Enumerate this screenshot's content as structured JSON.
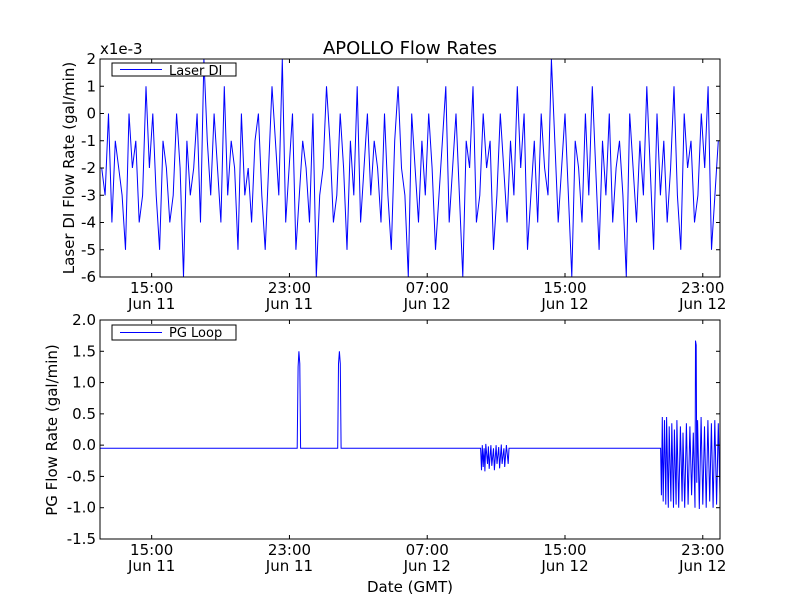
{
  "chart_data": [
    {
      "type": "line",
      "title": "APOLLO Flow Rates",
      "ylabel": "Laser DI Flow Rate (gal/min)",
      "xlabel": "",
      "scale_note": "x1e-3",
      "legend": [
        "Laser DI"
      ],
      "legend_position": "top-left",
      "color": "#0000ff",
      "x_unit": "hours since Jun 11 12:00 GMT",
      "xlim": [
        0,
        36
      ],
      "ylim": [
        -6,
        2
      ],
      "yticks": [
        "-6",
        "-5",
        "-4",
        "-3",
        "-2",
        "-1",
        "0",
        "1",
        "2"
      ],
      "xticks": [
        {
          "at": 3,
          "time": "15:00",
          "date": "Jun 11"
        },
        {
          "at": 11,
          "time": "23:00",
          "date": "Jun 11"
        },
        {
          "at": 19,
          "time": "07:00",
          "date": "Jun 12"
        },
        {
          "at": 27,
          "time": "15:00",
          "date": "Jun 12"
        },
        {
          "at": 35,
          "time": "23:00",
          "date": "Jun 12"
        }
      ],
      "series": [
        {
          "name": "Laser DI",
          "values": [
            -2,
            -3,
            0,
            -4,
            -1,
            -2,
            -3,
            -5,
            0,
            -2,
            -1,
            -4,
            -3,
            1,
            -2,
            0,
            -3,
            -5,
            -1,
            -2,
            -4,
            -3,
            0,
            -2,
            -6,
            -1,
            -3,
            -2,
            0,
            -4,
            2,
            -1,
            -3,
            0,
            -2,
            -4,
            1,
            -3,
            -1,
            -2,
            -5,
            0,
            -3,
            -2,
            -4,
            -1,
            0,
            -3,
            -5,
            -2,
            1,
            -1,
            -3,
            2,
            -4,
            -2,
            0,
            -5,
            -3,
            -1,
            -2,
            -4,
            0,
            -6,
            -3,
            -2,
            1,
            -1,
            -4,
            -3,
            0,
            -2,
            -5,
            -1,
            -3,
            1,
            -4,
            -2,
            0,
            -3,
            -1,
            -2,
            -4,
            0,
            -3,
            -5,
            -1,
            1,
            -2,
            -3,
            -6,
            0,
            -2,
            -4,
            -1,
            -3,
            0,
            -2,
            -5,
            -3,
            -1,
            1,
            -4,
            -2,
            0,
            -3,
            -6,
            -1,
            -2,
            1,
            -4,
            -3,
            0,
            -2,
            -1,
            -5,
            -3,
            0,
            -2,
            -4,
            -1,
            -3,
            1,
            -2,
            0,
            -5,
            -3,
            -1,
            -4,
            0,
            -2,
            -3,
            2,
            -1,
            -4,
            -2,
            0,
            -3,
            -6,
            -1,
            -2,
            -4,
            0,
            -3,
            1,
            -2,
            -5,
            -1,
            -3,
            0,
            -4,
            -2,
            -1,
            -3,
            -6,
            0,
            -2,
            -4,
            -1,
            -3,
            1,
            -2,
            -5,
            0,
            -3,
            -1,
            -4,
            -2,
            1,
            -3,
            -5,
            0,
            -2,
            -1,
            -4,
            -3,
            0,
            -2,
            1,
            -5,
            -3,
            -1
          ]
        }
      ]
    },
    {
      "type": "line",
      "title": "",
      "ylabel": "PG Flow Rate (gal/min)",
      "xlabel": "Date (GMT)",
      "legend": [
        "PG Loop"
      ],
      "legend_position": "top-left",
      "color": "#0000ff",
      "x_unit": "hours since Jun 11 12:00 GMT",
      "xlim": [
        0,
        36
      ],
      "ylim": [
        -1.5,
        2.0
      ],
      "yticks": [
        "-1.5",
        "-1.0",
        "-0.5",
        "0.0",
        "0.5",
        "1.0",
        "1.5",
        "2.0"
      ],
      "xticks": [
        {
          "at": 3,
          "time": "15:00",
          "date": "Jun 11"
        },
        {
          "at": 11,
          "time": "23:00",
          "date": "Jun 11"
        },
        {
          "at": 19,
          "time": "07:00",
          "date": "Jun 12"
        },
        {
          "at": 27,
          "time": "15:00",
          "date": "Jun 12"
        },
        {
          "at": 35,
          "time": "23:00",
          "date": "Jun 12"
        }
      ],
      "series": [
        {
          "name": "PG Loop",
          "points": [
            [
              0,
              -0.05
            ],
            [
              11.45,
              -0.05
            ],
            [
              11.5,
              1.25
            ],
            [
              11.55,
              1.5
            ],
            [
              11.6,
              1.3
            ],
            [
              11.65,
              -0.05
            ],
            [
              13.8,
              -0.05
            ],
            [
              13.85,
              1.3
            ],
            [
              13.9,
              1.5
            ],
            [
              13.95,
              1.3
            ],
            [
              14.0,
              -0.05
            ],
            [
              22.1,
              -0.05
            ],
            [
              22.15,
              -0.4
            ],
            [
              22.2,
              0.0
            ],
            [
              22.25,
              -0.35
            ],
            [
              22.3,
              -0.05
            ],
            [
              22.35,
              -0.42
            ],
            [
              22.4,
              0.02
            ],
            [
              22.5,
              -0.3
            ],
            [
              22.55,
              -0.02
            ],
            [
              22.6,
              -0.38
            ],
            [
              22.7,
              0.0
            ],
            [
              22.75,
              -0.33
            ],
            [
              22.85,
              -0.05
            ],
            [
              22.9,
              -0.4
            ],
            [
              23.0,
              0.0
            ],
            [
              23.05,
              -0.3
            ],
            [
              23.15,
              -0.03
            ],
            [
              23.2,
              -0.37
            ],
            [
              23.3,
              0.01
            ],
            [
              23.35,
              -0.3
            ],
            [
              23.45,
              -0.05
            ],
            [
              23.5,
              -0.35
            ],
            [
              23.6,
              0.0
            ],
            [
              23.7,
              -0.3
            ],
            [
              23.75,
              -0.05
            ],
            [
              32.55,
              -0.05
            ],
            [
              32.6,
              -0.8
            ],
            [
              32.65,
              0.45
            ],
            [
              32.7,
              -0.9
            ],
            [
              32.78,
              0.4
            ],
            [
              32.85,
              -0.95
            ],
            [
              32.9,
              0.45
            ],
            [
              33.0,
              -1.0
            ],
            [
              33.05,
              0.3
            ],
            [
              33.15,
              -0.9
            ],
            [
              33.2,
              0.35
            ],
            [
              33.3,
              -1.0
            ],
            [
              33.35,
              0.25
            ],
            [
              33.45,
              -0.95
            ],
            [
              33.5,
              0.4
            ],
            [
              33.6,
              -1.0
            ],
            [
              33.7,
              0.3
            ],
            [
              33.8,
              -0.9
            ],
            [
              33.85,
              0.2
            ],
            [
              33.95,
              -1.0
            ],
            [
              34.05,
              0.35
            ],
            [
              34.15,
              -0.95
            ],
            [
              34.25,
              0.3
            ],
            [
              34.35,
              -0.8
            ],
            [
              34.45,
              0.2
            ],
            [
              34.55,
              -1.0
            ],
            [
              34.58,
              1.67
            ],
            [
              34.62,
              1.6
            ],
            [
              34.65,
              -0.6
            ],
            [
              34.7,
              0.4
            ],
            [
              34.8,
              -1.02
            ],
            [
              34.9,
              0.45
            ],
            [
              35.0,
              -0.95
            ],
            [
              35.1,
              0.3
            ],
            [
              35.2,
              -1.0
            ],
            [
              35.3,
              0.4
            ],
            [
              35.4,
              -0.9
            ],
            [
              35.5,
              0.35
            ],
            [
              35.6,
              -1.0
            ],
            [
              35.7,
              0.4
            ],
            [
              35.8,
              -0.95
            ],
            [
              35.9,
              0.35
            ],
            [
              36,
              -0.8
            ]
          ]
        }
      ]
    }
  ]
}
